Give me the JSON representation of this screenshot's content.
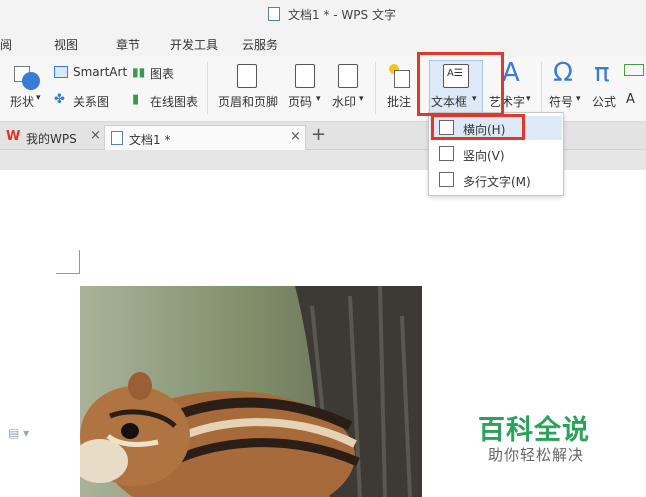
{
  "window": {
    "title": "文档1 * - WPS 文字"
  },
  "menu": {
    "items": [
      "审阅",
      "视图",
      "章节",
      "开发工具",
      "云服务"
    ]
  },
  "ribbon": {
    "shape": "形状",
    "smartart": "SmartArt",
    "chart": "图表",
    "relation": "关系图",
    "online_chart": "在线图表",
    "header_footer": "页眉和页脚",
    "page_number": "页码",
    "watermark": "水印",
    "comment": "批注",
    "textbox": "文本框",
    "wordart": "艺术字",
    "symbol": "符号",
    "formula": "公式"
  },
  "tabs": [
    {
      "label": "我的WPS"
    },
    {
      "label": "文档1 *"
    }
  ],
  "dropdown": {
    "items": [
      "横向(H)",
      "竖向(V)",
      "多行文字(M)"
    ]
  },
  "watermark_text": {
    "main": "百科全说",
    "sub": "助你轻松解决"
  },
  "colors": {
    "highlight": "#e0392c",
    "brand_green": "#2aa35a",
    "wps_red": "#d9342b"
  }
}
